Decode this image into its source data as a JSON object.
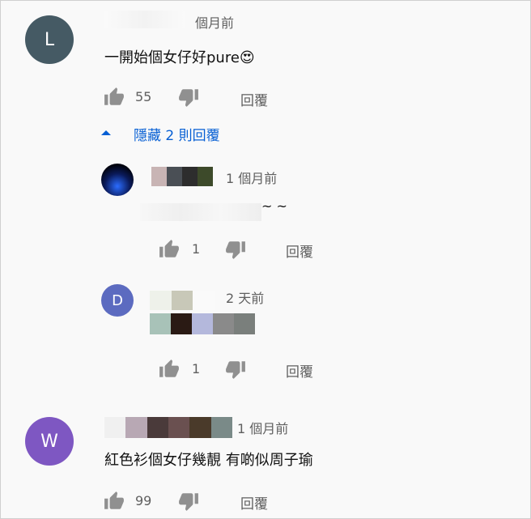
{
  "comments": [
    {
      "avatar_letter": "L",
      "avatar_color": "#455a64",
      "time": "個月前",
      "text": "一開始個女仔好pure😍",
      "likes": "55",
      "reply_label": "回覆"
    },
    {
      "avatar_letter": "W",
      "avatar_color": "#7e57c2",
      "time": "1 個月前",
      "text": "紅色衫個女仔幾靚 有啲似周子瑜",
      "likes": "99",
      "reply_label": "回覆"
    }
  ],
  "replies_toggle": "隱藏 2 則回覆",
  "replies": [
    {
      "time": "1 個月前",
      "text_tail": "~ ~",
      "likes": "1",
      "reply_label": "回覆"
    },
    {
      "avatar_letter": "D",
      "avatar_color": "#5c6bc0",
      "time": "2 天前",
      "likes": "1",
      "reply_label": "回覆"
    }
  ],
  "colors": {
    "link_blue": "#065fd4",
    "secondary_text": "#606060"
  }
}
